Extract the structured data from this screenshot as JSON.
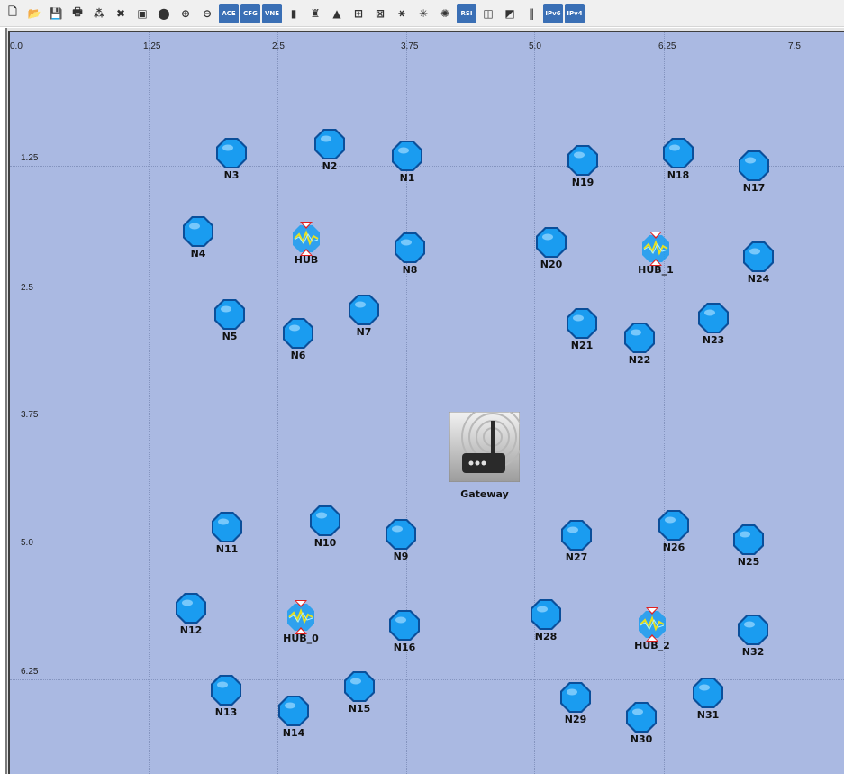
{
  "toolbar": {
    "items": [
      {
        "name": "new-icon",
        "glyph": "🗋"
      },
      {
        "name": "open-folder-icon",
        "glyph": "📂"
      },
      {
        "name": "save-icon",
        "glyph": "💾"
      },
      {
        "name": "print-icon",
        "glyph": "🖶"
      },
      {
        "name": "network-icon",
        "glyph": "⁂"
      },
      {
        "name": "delete-icon",
        "glyph": "✖"
      },
      {
        "name": "export-icon",
        "glyph": "▣"
      },
      {
        "name": "record-icon",
        "glyph": "⬤"
      },
      {
        "name": "zoom-in-icon",
        "glyph": "⊕"
      },
      {
        "name": "zoom-out-icon",
        "glyph": "⊖"
      },
      {
        "name": "ace-icon",
        "glyph": "ACE"
      },
      {
        "name": "cfg-icon",
        "glyph": "CFG"
      },
      {
        "name": "vne-icon",
        "glyph": "VNE"
      },
      {
        "name": "traffic-light-icon",
        "glyph": "▮"
      },
      {
        "name": "tower-icon",
        "glyph": "♜"
      },
      {
        "name": "triangle-icon",
        "glyph": "▲"
      },
      {
        "name": "topology-icon",
        "glyph": "⊞"
      },
      {
        "name": "topology-remove-icon",
        "glyph": "⊠"
      },
      {
        "name": "wand-icon",
        "glyph": "⚹"
      },
      {
        "name": "mesh-icon",
        "glyph": "✳"
      },
      {
        "name": "wireless-icon",
        "glyph": "✺"
      },
      {
        "name": "rsi-icon",
        "glyph": "RSI"
      },
      {
        "name": "layers-icon",
        "glyph": "◫"
      },
      {
        "name": "graph-icon",
        "glyph": "◩"
      },
      {
        "name": "ruler-icon",
        "glyph": "‖"
      },
      {
        "name": "ipv6-icon",
        "glyph": "IPv6"
      },
      {
        "name": "ipv4-ipv6-icon",
        "glyph": "IPv4"
      }
    ]
  },
  "axis": {
    "x_ticks": [
      {
        "label": "0.0"
      },
      {
        "label": "1.25"
      },
      {
        "label": "2.5"
      },
      {
        "label": "3.75"
      },
      {
        "label": "5.0"
      },
      {
        "label": "6.25"
      },
      {
        "label": "7.5"
      }
    ],
    "y_ticks": [
      {
        "label": "1.25"
      },
      {
        "label": "2.5"
      },
      {
        "label": "3.75"
      },
      {
        "label": "5.0"
      },
      {
        "label": "6.25"
      }
    ]
  },
  "colors": {
    "canvas_bg": "#aab9e2",
    "node_fill": "#1a9cf0",
    "node_outline": "#0b4f9a"
  },
  "gateway": {
    "label": "Gateway"
  },
  "nodes": [
    {
      "label": "N3",
      "type": "node"
    },
    {
      "label": "N2",
      "type": "node"
    },
    {
      "label": "N1",
      "type": "node"
    },
    {
      "label": "N19",
      "type": "node"
    },
    {
      "label": "N18",
      "type": "node"
    },
    {
      "label": "N17",
      "type": "node"
    },
    {
      "label": "N4",
      "type": "node"
    },
    {
      "label": "HUB",
      "type": "hub"
    },
    {
      "label": "N8",
      "type": "node"
    },
    {
      "label": "N20",
      "type": "node"
    },
    {
      "label": "HUB_1",
      "type": "hub"
    },
    {
      "label": "N24",
      "type": "node"
    },
    {
      "label": "N5",
      "type": "node"
    },
    {
      "label": "N6",
      "type": "node"
    },
    {
      "label": "N7",
      "type": "node"
    },
    {
      "label": "N21",
      "type": "node"
    },
    {
      "label": "N22",
      "type": "node"
    },
    {
      "label": "N23",
      "type": "node"
    },
    {
      "label": "N11",
      "type": "node"
    },
    {
      "label": "N10",
      "type": "node"
    },
    {
      "label": "N9",
      "type": "node"
    },
    {
      "label": "N27",
      "type": "node"
    },
    {
      "label": "N26",
      "type": "node"
    },
    {
      "label": "N25",
      "type": "node"
    },
    {
      "label": "N12",
      "type": "node"
    },
    {
      "label": "HUB_0",
      "type": "hub"
    },
    {
      "label": "N16",
      "type": "node"
    },
    {
      "label": "N28",
      "type": "node"
    },
    {
      "label": "HUB_2",
      "type": "hub"
    },
    {
      "label": "N32",
      "type": "node"
    },
    {
      "label": "N13",
      "type": "node"
    },
    {
      "label": "N14",
      "type": "node"
    },
    {
      "label": "N15",
      "type": "node"
    },
    {
      "label": "N29",
      "type": "node"
    },
    {
      "label": "N30",
      "type": "node"
    },
    {
      "label": "N31",
      "type": "node"
    }
  ]
}
